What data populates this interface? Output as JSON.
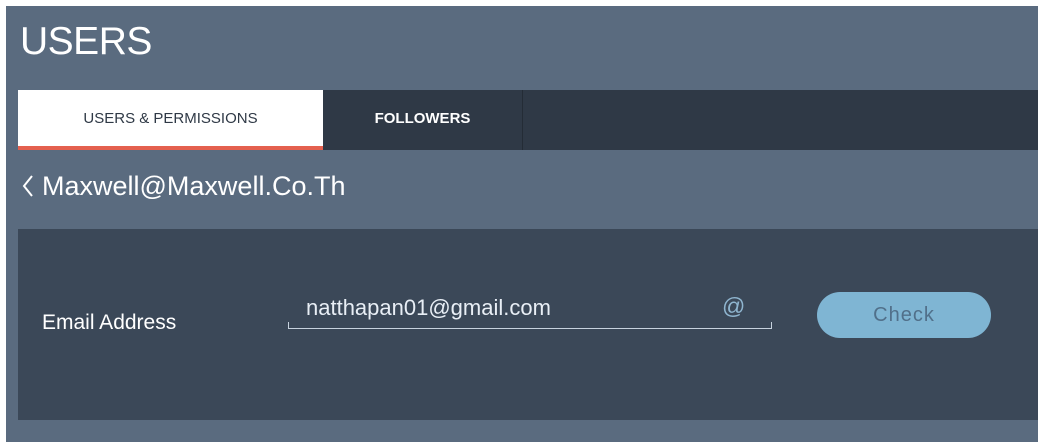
{
  "header": {
    "title": "USERS"
  },
  "tabs": [
    {
      "label": "USERS & PERMISSIONS",
      "active": true
    },
    {
      "label": "FOLLOWERS",
      "active": false
    }
  ],
  "breadcrumb": {
    "back_icon": "chevron-left-icon",
    "text": "Maxwell@Maxwell.Co.Th"
  },
  "form": {
    "email_label": "Email Address",
    "email_value": "natthapan01@gmail.com",
    "email_icon_glyph": "@",
    "check_label": "Check"
  },
  "colors": {
    "background": "#5a6b7f",
    "tabbar": "#2f3946",
    "active_tab_underline": "#e4604f",
    "panel": "#3b4858",
    "check_button": "#7fb5d3"
  }
}
